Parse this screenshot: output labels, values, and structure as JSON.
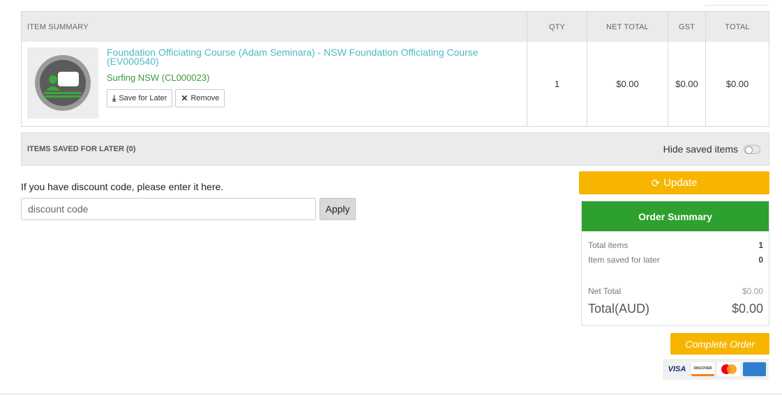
{
  "cart": {
    "headers": {
      "item": "ITEM SUMMARY",
      "qty": "QTY",
      "net_total": "NET TOTAL",
      "gst": "GST",
      "total": "TOTAL"
    },
    "item": {
      "title": "Foundation Officiating Course (Adam Seminara) - NSW Foundation Officiating Course (EV000540)",
      "organisation": "Surfing NSW (CL000023)",
      "save_label": "Save for Later",
      "remove_label": "Remove",
      "qty": "1",
      "net_total": "$0.00",
      "gst": "$0.00",
      "total": "$0.00"
    }
  },
  "saved": {
    "title": "ITEMS SAVED FOR LATER (0)",
    "hide_label": "Hide saved items",
    "hide_enabled": false
  },
  "discount": {
    "prompt": "If you have discount code, please enter it here.",
    "placeholder": "discount code",
    "apply_label": "Apply"
  },
  "update_label": "Update",
  "order_summary": {
    "title": "Order Summary",
    "total_items_label": "Total items",
    "total_items": "1",
    "saved_label": "Item saved for later",
    "saved_count": "0",
    "net_total_label": "Net Total",
    "net_total": "$0.00",
    "total_label": "Total(AUD)",
    "total": "$0.00"
  },
  "complete_label": "Complete Order",
  "payment_cards": [
    "VISA",
    "DISCOVER",
    "mastercard",
    "AMERICAN EXPRESS"
  ],
  "colors": {
    "accent_yellow": "#f7b500",
    "summary_green": "#2ea02e",
    "link_teal": "#4db8c7",
    "org_green": "#3a9a3a"
  }
}
